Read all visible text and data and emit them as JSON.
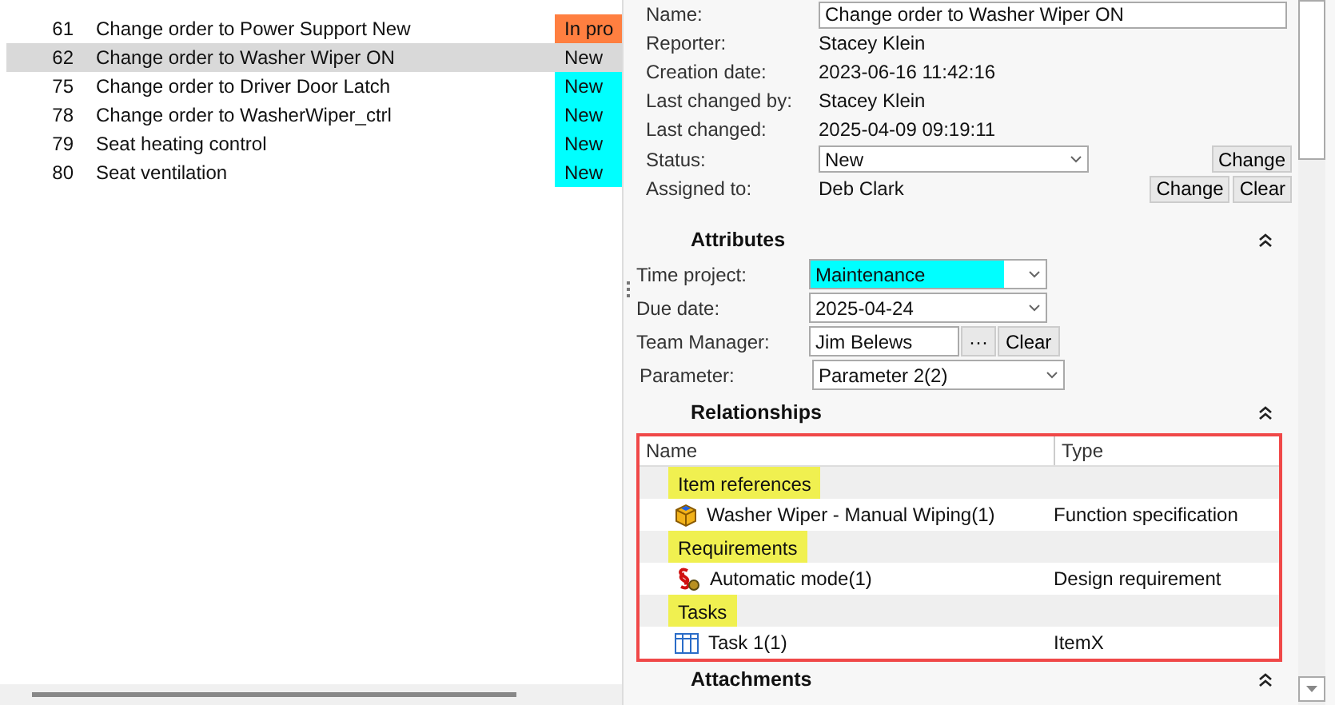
{
  "task_list": {
    "rows": [
      {
        "id": "61",
        "name": "Change order to Power Support New",
        "status": "In pro",
        "color": "#ff7f40",
        "selected": false
      },
      {
        "id": "62",
        "name": "Change order to Washer Wiper ON",
        "status": "New",
        "selected": true
      },
      {
        "id": "75",
        "name": "Change order to Driver Door Latch",
        "status": "New",
        "color": "#00ffff",
        "selected": false
      },
      {
        "id": "78",
        "name": "Change order to WasherWiper_ctrl",
        "status": "New",
        "color": "#00ffff",
        "selected": false
      },
      {
        "id": "79",
        "name": "Seat heating control",
        "status": "New",
        "color": "#00ffff",
        "selected": false
      },
      {
        "id": "80",
        "name": "Seat ventilation",
        "status": "New",
        "color": "#00ffff",
        "selected": false
      }
    ]
  },
  "details": {
    "fields": [
      {
        "label": "Name:",
        "value": "Change order to Washer Wiper ON",
        "kind": "input"
      },
      {
        "label": "Reporter:",
        "value": "Stacey Klein",
        "kind": "text"
      },
      {
        "label": "Creation date:",
        "value": "2023-06-16 11:42:16",
        "kind": "text"
      },
      {
        "label": "Last changed by:",
        "value": "Stacey Klein",
        "kind": "text"
      },
      {
        "label": "Last changed:",
        "value": "2025-04-09 09:19:11",
        "kind": "text"
      },
      {
        "label": "Status:",
        "value": "New",
        "kind": "dropdown",
        "buttons": [
          "Change"
        ]
      },
      {
        "label": "Assigned to:",
        "value": "Deb Clark",
        "kind": "text",
        "buttons": [
          "Change",
          "Clear"
        ]
      }
    ]
  },
  "attributes": {
    "title": "Attributes",
    "fields": [
      {
        "label": "Time project:",
        "value": "Maintenance",
        "kind": "dropdown",
        "color": "#00ffff"
      },
      {
        "label": "Due date:",
        "value": "2025-04-24",
        "kind": "dropdown"
      },
      {
        "label": "Team Manager:",
        "value": "Jim Belews",
        "kind": "picker",
        "buttons": [
          "···",
          "Clear"
        ]
      },
      {
        "label": "Parameter:",
        "value": "Parameter 2(2)",
        "kind": "dropdown"
      }
    ]
  },
  "relationships": {
    "title": "Relationships",
    "columns": [
      "Name",
      "Type"
    ],
    "groups": [
      {
        "label": "Item references",
        "highlighted": true,
        "items": [
          {
            "name": "Washer Wiper - Manual Wiping(1)",
            "type": "Function specification",
            "kind": "function"
          }
        ]
      },
      {
        "label": "Requirements",
        "highlighted": true,
        "items": [
          {
            "name": "Automatic mode(1)",
            "type": "Design requirement",
            "kind": "requirement"
          }
        ]
      },
      {
        "label": "Tasks",
        "highlighted": true,
        "items": [
          {
            "name": "Task 1(1)",
            "type": "ItemX",
            "kind": "task"
          }
        ]
      }
    ]
  },
  "attachments": {
    "title": "Attachments"
  }
}
